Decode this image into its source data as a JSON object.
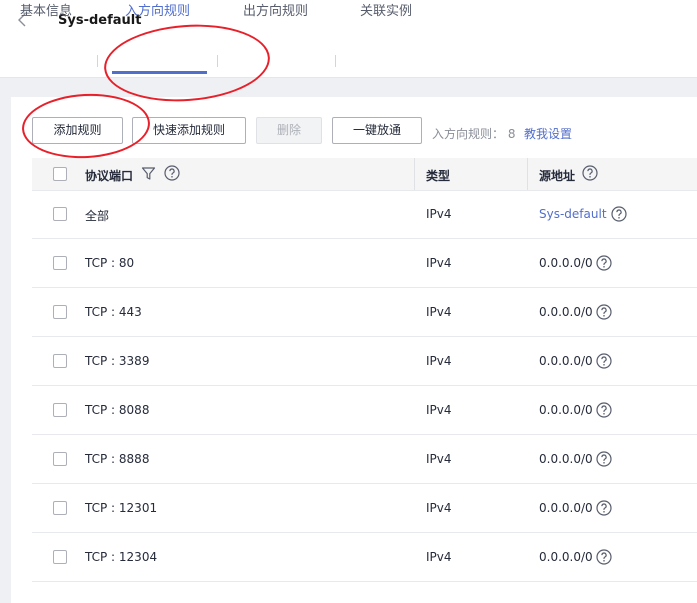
{
  "header": {
    "title": "Sys-default"
  },
  "tabs": [
    {
      "label": "基本信息",
      "active": false
    },
    {
      "label": "入方向规则",
      "active": true
    },
    {
      "label": "出方向规则",
      "active": false
    },
    {
      "label": "关联实例",
      "active": false
    }
  ],
  "toolbar": {
    "add_rule": "添加规则",
    "quick_add": "快速添加规则",
    "delete": "删除",
    "allow_all": "一键放通",
    "count_label": "入方向规则： 8",
    "help_link": "教我设置"
  },
  "table": {
    "columns": [
      "协议端口",
      "类型",
      "源地址"
    ],
    "rows": [
      {
        "port": "全部",
        "type": "IPv4",
        "source": "Sys-default",
        "source_is_link": true
      },
      {
        "port": "TCP : 80",
        "type": "IPv4",
        "source": "0.0.0.0/0"
      },
      {
        "port": "TCP : 443",
        "type": "IPv4",
        "source": "0.0.0.0/0"
      },
      {
        "port": "TCP : 3389",
        "type": "IPv4",
        "source": "0.0.0.0/0"
      },
      {
        "port": "TCP : 8088",
        "type": "IPv4",
        "source": "0.0.0.0/0"
      },
      {
        "port": "TCP : 8888",
        "type": "IPv4",
        "source": "0.0.0.0/0"
      },
      {
        "port": "TCP : 12301",
        "type": "IPv4",
        "source": "0.0.0.0/0"
      },
      {
        "port": "TCP : 12304",
        "type": "IPv4",
        "source": "0.0.0.0/0"
      }
    ]
  },
  "icons": {
    "back": "chevron-left-icon",
    "help": "help-circle-icon",
    "filter": "filter-icon"
  },
  "colors": {
    "accent": "#526ecc",
    "annotation": "#e8202a"
  }
}
